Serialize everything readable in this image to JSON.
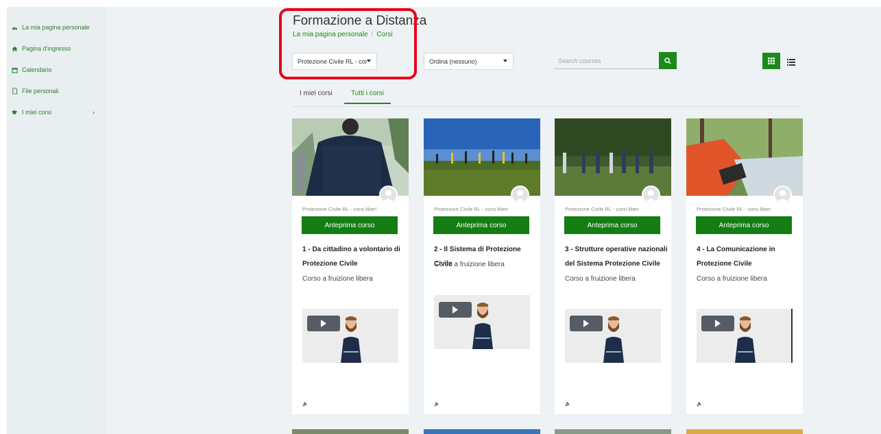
{
  "sidebar": {
    "items": [
      {
        "label": "La mia pagina personale",
        "icon": "dashboard-icon"
      },
      {
        "label": "Pagina d'ingresso",
        "icon": "home-icon"
      },
      {
        "label": "Calendario",
        "icon": "calendar-icon"
      },
      {
        "label": "File personali",
        "icon": "file-icon"
      },
      {
        "label": "I miei corsi",
        "icon": "graduation-cap-icon",
        "chevron": "›"
      }
    ]
  },
  "header": {
    "title": "Formazione a Distanza",
    "breadcrumb": [
      "La mia pagina personale",
      "Corsi"
    ],
    "breadcrumb_sep": "/"
  },
  "filters": {
    "category_select": "Protezione Civile RL - cor",
    "sort_select": "Ordina (nessuno)",
    "search_placeholder": "Search courses"
  },
  "tabs": [
    {
      "label": "I miei corsi",
      "active": false
    },
    {
      "label": "Tutti i corsi",
      "active": true
    }
  ],
  "courses": [
    {
      "category": "Protezione Civile RL - corsi liberi",
      "button": "Anteprima corso",
      "name": "1 - Da cittadino a volontario di Protezione Civile",
      "summary": "Corso a fruizione libera"
    },
    {
      "category": "Protezione Civile RL - corsi liberi",
      "button": "Anteprima corso",
      "name": "2 - Il Sistema di Protezione Civile",
      "summary": "Corso a fruizione libera"
    },
    {
      "category": "Protezione Civile RL - corsi liberi",
      "button": "Anteprima corso",
      "name": "3 - Strutture operative nazionali del Sistema Protezione Civile",
      "summary": "Corso a fruizione libera"
    },
    {
      "category": "Protezione Civile RL - corsi liberi",
      "button": "Anteprima corso",
      "name": "4 - La Comunicazione in Protezione Civile",
      "summary": "Corso a fruizione libera"
    }
  ],
  "colors": {
    "accent": "#1b8a1b",
    "button": "#147d14",
    "highlight": "#e5001a",
    "background": "#eef2f4"
  }
}
